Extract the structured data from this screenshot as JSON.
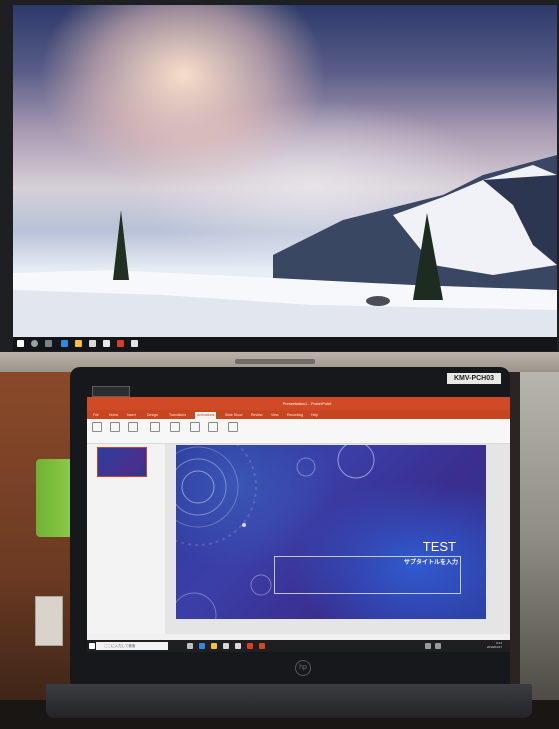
{
  "external_monitor": {
    "taskbar_icons": [
      "windows-icon",
      "search-icon",
      "task-view-icon",
      "edge-icon",
      "folder-icon",
      "store-icon",
      "mail-icon",
      "office-icon",
      "powerpoint-icon"
    ]
  },
  "laptop": {
    "asset_sticker": "KMV-PCH03",
    "powerpoint": {
      "window_title": "Presentation1 - PowerPoint",
      "tabs": [
        "File",
        "Home",
        "Insert",
        "Design",
        "Transitions",
        "Animations",
        "Slide Show",
        "Review",
        "View",
        "Recording",
        "Help"
      ],
      "active_tab": "Animations",
      "slide_title": "TEST",
      "slide_subtitle": "サブタイトルを入力"
    },
    "taskbar": {
      "search_placeholder": "ここに入力して検索",
      "clock_time": "9:14",
      "clock_date": "2019/04/17"
    }
  },
  "colors": {
    "powerpoint_accent": "#d04a25",
    "slide_bg": "#2f3fa0"
  }
}
